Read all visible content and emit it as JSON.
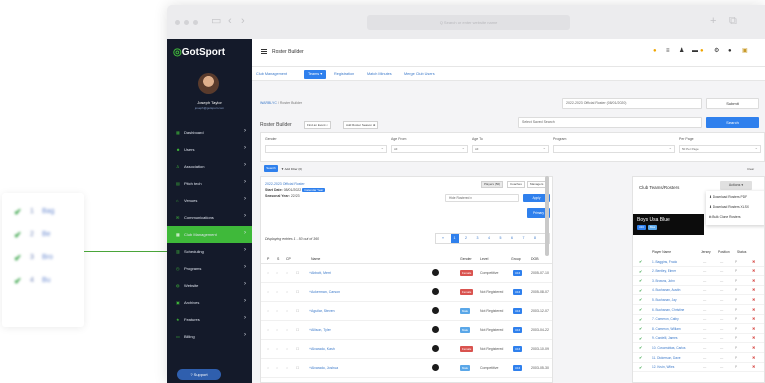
{
  "floating_card": {
    "rows": [
      {
        "num": "1",
        "name": "Bag"
      },
      {
        "num": "2",
        "name": "Be"
      },
      {
        "num": "3",
        "name": "Bro"
      },
      {
        "num": "4",
        "name": "Bu"
      }
    ]
  },
  "browser": {
    "url": "Q  Search or enter website name"
  },
  "sidebar": {
    "logo": "GotSport",
    "user_name": "Joseph Taylor",
    "user_email": "joseph@gotsport.com",
    "items": [
      {
        "icon": "dashboard-icon",
        "glyph": "▦",
        "label": "Dashboard"
      },
      {
        "icon": "users-icon",
        "glyph": "☻",
        "label": "Users"
      },
      {
        "icon": "association-icon",
        "glyph": "♙",
        "label": "Association"
      },
      {
        "icon": "pitch-icon",
        "glyph": "▤",
        "label": "Pitch tech"
      },
      {
        "icon": "venues-icon",
        "glyph": "⌂",
        "label": "Venues"
      },
      {
        "icon": "communications-icon",
        "glyph": "✉",
        "label": "Communications"
      },
      {
        "icon": "club-management-icon",
        "glyph": "▦",
        "label": "Club Management"
      },
      {
        "icon": "scheduling-icon",
        "glyph": "▥",
        "label": "Scheduling"
      },
      {
        "icon": "programs-icon",
        "glyph": "◷",
        "label": "Programs"
      },
      {
        "icon": "website-icon",
        "glyph": "◍",
        "label": "Website"
      },
      {
        "icon": "archives-icon",
        "glyph": "▣",
        "label": "Archives"
      },
      {
        "icon": "features-icon",
        "glyph": "★",
        "label": "Features"
      },
      {
        "icon": "billing-icon",
        "glyph": "▭",
        "label": "Billing"
      }
    ],
    "support_label": "Support"
  },
  "topbar": {
    "title": "Roster Builder"
  },
  "navtabs": [
    "Club Management",
    "Teams",
    "Registration",
    "Match Minutes",
    "Merge Club Users"
  ],
  "breadcrumb": {
    "first": "WARBLYC",
    "second": "Roster Builder"
  },
  "roster_select": "2022-2023 Official Roster (08/01/2020)",
  "saved_search_placeholder": "Select Saved Search",
  "submit_label": "Submit",
  "search_label": "Search",
  "rb": {
    "title": "Roster Builder",
    "find_event": "Find an Event",
    "add_roster_season": "Add Roster Season"
  },
  "filters": {
    "gender": {
      "label": "Gender",
      "value": ""
    },
    "age_from": {
      "label": "Age From",
      "value": "All"
    },
    "age_to": {
      "label": "Age To",
      "value": "All"
    },
    "program": {
      "label": "Program",
      "value": ""
    },
    "per_page": {
      "label": "Per Page",
      "value": "50 Per Page"
    },
    "search_button": "Search",
    "add_filter": "Add Filter (0)",
    "clear": "Clear"
  },
  "event": {
    "link": "2022-2023 Official Roster",
    "start_label": "Start Date:",
    "start_value": "08/01/2022",
    "start_tag": "Calendar Year",
    "season_label": "Seasonal Year:",
    "season_value": "22/23",
    "tabs": [
      "Players (50)",
      "Coaches",
      "Managers"
    ],
    "hide_select": "Hide Rostered",
    "apply_label": "Apply",
    "primary_label": "Primary"
  },
  "showing": "Displaying entries 1 - 50 out of 360",
  "pager": [
    "«",
    "1",
    "2",
    "3",
    "4",
    "5",
    "6",
    "7",
    "8",
    "»"
  ],
  "table": {
    "headers": [
      "P",
      "S",
      "CP",
      "",
      "Name",
      "",
      "Gender",
      "Level",
      "Group",
      "DOB"
    ],
    "rows": [
      {
        "name": "Abbott, Merri",
        "gender": "Female",
        "gclass": "b-red",
        "level": "Competitive",
        "dob": "2005-07-10"
      },
      {
        "name": "Ackerman, Carson",
        "gender": "Female",
        "gclass": "b-red",
        "level": "Not Registered",
        "dob": "2005-08-07"
      },
      {
        "name": "Aguilar, Steven",
        "gender": "Male",
        "gclass": "b-blue",
        "level": "Not Registered",
        "dob": "2003-12-07"
      },
      {
        "name": "Allison, Tyler",
        "gender": "Male",
        "gclass": "b-blue",
        "level": "Not Registered",
        "dob": "2003-04-22"
      },
      {
        "name": "Alvarado, Kash",
        "gender": "Female",
        "gclass": "b-red",
        "level": "Not Registered",
        "dob": "2003-10-09"
      },
      {
        "name": "Alvarado, Joshua",
        "gender": "Male",
        "gclass": "b-blue",
        "level": "Competitive",
        "dob": "2003-05-30"
      }
    ]
  },
  "right_panel": {
    "title": "Club Teams/Rosters",
    "actions_label": "Actions",
    "dropdown": [
      "Download Rosters PDF",
      "Download Rosters XLSX",
      "Bulk Clone Rosters"
    ],
    "team_name": "Boys Usa Blue",
    "team_badges": [
      "U16",
      "Blue"
    ],
    "headers": [
      "Player Name",
      "Jersey",
      "Position",
      "Status"
    ],
    "players": [
      "1. Baggins, Frodo",
      "2. Bentley, Elmer",
      "3. Browns, John",
      "4. Buchanan, Austin",
      "5. Buchanan, Jay",
      "6. Buchanan, Christine",
      "7. Cameron, Cathy",
      "8. Cameron, William",
      "9. Cardelli, James",
      "10. Covarrubias, Carlos",
      "11. Dickerson, Dave",
      "12. Kruin, Wiles"
    ]
  }
}
